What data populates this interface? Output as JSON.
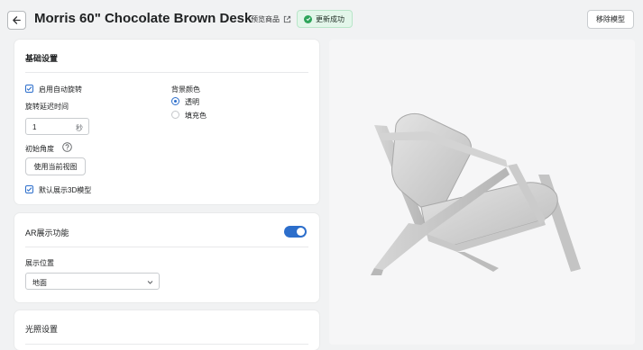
{
  "header": {
    "title": "Morris 60\" Chocolate Brown Desk",
    "preview_label": "预览商品",
    "status_badge": "更新成功",
    "remove_button": "移除模型"
  },
  "basic_settings": {
    "title": "基础设置",
    "auto_rotate_label": "启用自动旋转",
    "auto_rotate_checked": true,
    "rotate_delay_label": "旋转延迟时间",
    "rotate_delay_value": "1",
    "rotate_delay_unit": "秒",
    "background_color_label": "背景颜色",
    "background_options": [
      "透明",
      "填充色"
    ],
    "background_selected": "透明",
    "initial_angle_label": "初始角度",
    "use_current_view_button": "使用当前视图",
    "default_3d_label": "默认展示3D模型",
    "default_3d_checked": true
  },
  "ar_settings": {
    "title": "AR展示功能",
    "enabled": true,
    "position_label": "展示位置",
    "position_value": "地面"
  },
  "lighting": {
    "title": "光照设置"
  },
  "colors": {
    "accent": "#2c6ecb",
    "success": "#2ea55a",
    "success_bg": "#e3f6ea"
  }
}
